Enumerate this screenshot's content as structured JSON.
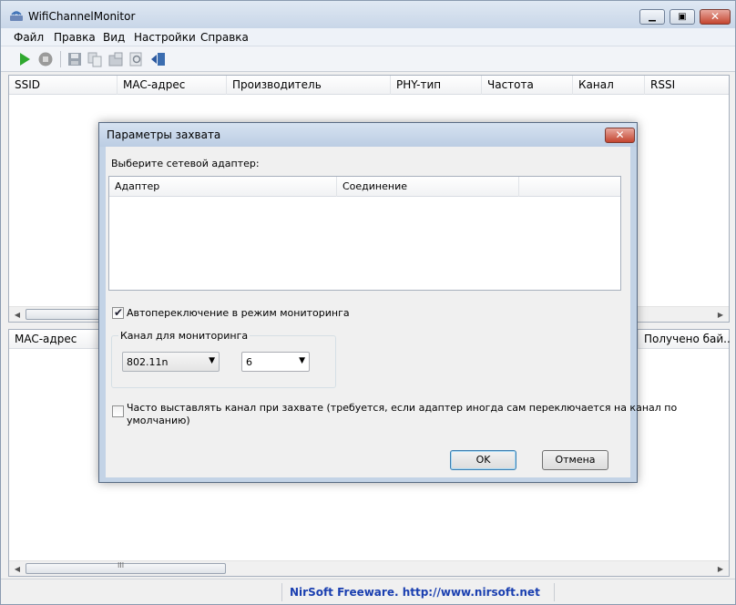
{
  "window": {
    "title": "WifiChannelMonitor"
  },
  "menu": [
    "Файл",
    "Правка",
    "Вид",
    "Настройки",
    "Справка"
  ],
  "upper_table": {
    "columns": [
      "SSID",
      "MAC-адрес",
      "Производитель",
      "PHY-тип",
      "Частота",
      "Канал",
      "RSSI"
    ]
  },
  "lower_table": {
    "columns": [
      "MAC-адрес",
      "Получено бай..."
    ]
  },
  "scroll_thumb_glyph": "III",
  "status": {
    "text": "NirSoft Freeware.  http://www.nirsoft.net"
  },
  "dialog": {
    "title": "Параметры захвата",
    "select_label": "Выберите сетевой адаптер:",
    "adapter_columns": [
      "Адаптер",
      "Соединение"
    ],
    "auto_monitor_label": "Автопереключение в режим мониторинга",
    "auto_monitor_checked": true,
    "channel_group_label": "Канал для мониторинга",
    "mode_value": "802.11n",
    "channel_value": "6",
    "frequent_set_label_1": "Часто выставлять канал при захвате (требуется, если адаптер иногда сам переключается на канал по",
    "frequent_set_label_2": "умолчанию)",
    "frequent_set_checked": false,
    "ok_label": "OK",
    "cancel_label": "Отмена"
  },
  "colors": {
    "status_link": "#1a3fb0",
    "play_green": "#2fa82f",
    "close_red": "#c4452f"
  }
}
